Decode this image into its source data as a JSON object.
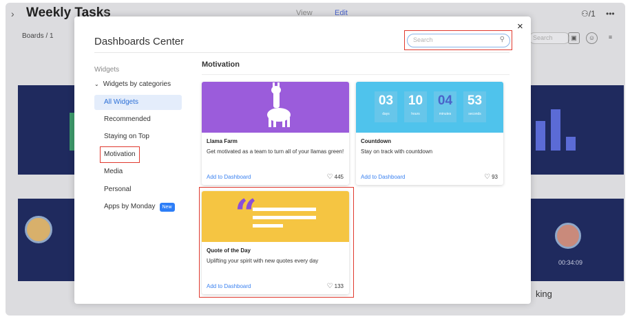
{
  "background": {
    "title": "Weekly Tasks",
    "view_label": "View",
    "edit_label": "Edit",
    "members": "/1",
    "boards": "Boards / 1",
    "search_placeholder": "Search",
    "time": "00:34:09",
    "king_text": "king"
  },
  "modal": {
    "title": "Dashboards Center",
    "search_placeholder": "Search",
    "close_label": "×",
    "sidebar": {
      "heading": "Widgets",
      "category_toggle": "Widgets by categories",
      "items": [
        {
          "label": "All Widgets"
        },
        {
          "label": "Recommended"
        },
        {
          "label": "Staying on Top"
        },
        {
          "label": "Motivation"
        },
        {
          "label": "Media"
        },
        {
          "label": "Personal"
        },
        {
          "label": "Apps by Monday",
          "badge": "New"
        }
      ]
    },
    "section_title": "Motivation",
    "cards": [
      {
        "title": "Llama Farm",
        "description": "Get motivated as a team to turn all of your llamas green!",
        "add_label": "Add to Dashboard",
        "likes": "445",
        "color": "#9b5cdb"
      },
      {
        "title": "Countdown",
        "description": "Stay on track with countdown",
        "add_label": "Add to Dashboard",
        "likes": "93",
        "color": "#4fc3ec",
        "countdown": [
          {
            "value": "03",
            "unit": "days"
          },
          {
            "value": "10",
            "unit": "hours"
          },
          {
            "value": "04",
            "unit": "minutes"
          },
          {
            "value": "53",
            "unit": "seconds"
          }
        ]
      },
      {
        "title": "Quote of the Day",
        "description": "Uplifting your spirit with new quotes every day",
        "add_label": "Add to Dashboard",
        "likes": "133",
        "color": "#f5c542"
      }
    ]
  },
  "colors": {
    "accent": "#3b82f0",
    "highlight": "#e0382d",
    "active_bg": "#e4edfb"
  }
}
